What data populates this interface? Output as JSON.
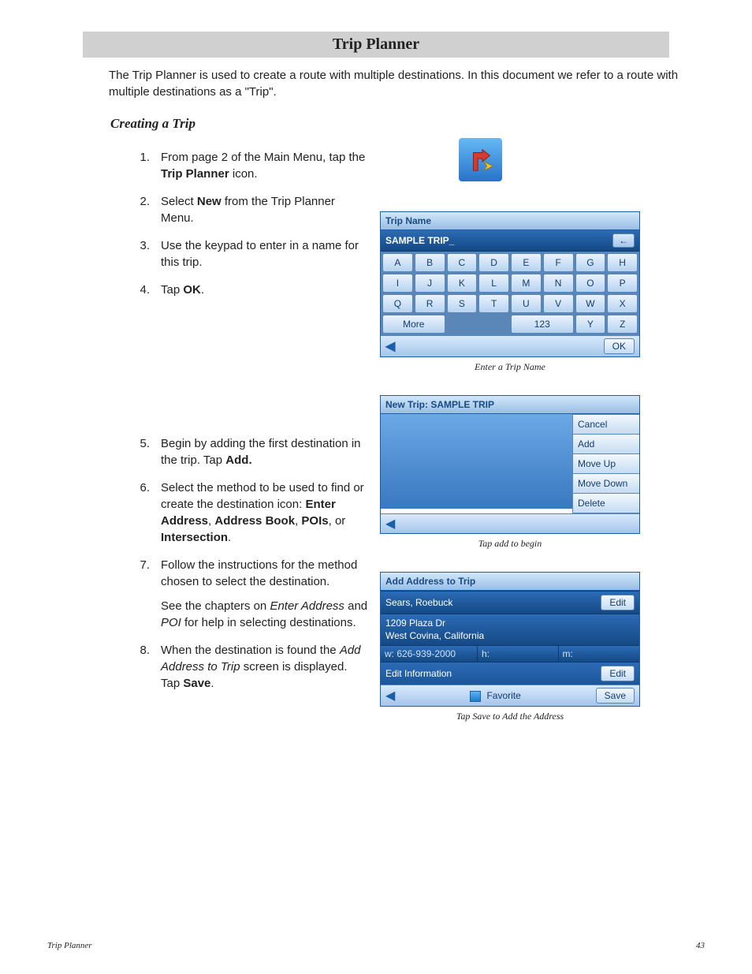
{
  "title": "Trip Planner",
  "intro": "The Trip Planner is used to create a route with multiple destinations.  In this document we refer to a route with multiple destinations as a \"Trip\".",
  "section_heading": "Creating a Trip",
  "steps": {
    "s1_pre": "From page 2 of the Main Menu, tap the ",
    "s1_bold": "Trip Planner",
    "s1_post": " icon.",
    "s2_pre": "Select ",
    "s2_bold": "New",
    "s2_post": " from the Trip Planner Menu.",
    "s3": "Use the keypad to enter in a name for this trip.",
    "s4_pre": "Tap ",
    "s4_bold": "OK",
    "s4_post": ".",
    "s5_pre": "Begin by adding the first destination in the trip.  Tap ",
    "s5_bold": "Add.",
    "s6_pre": "Select the method to be used to find or create the destination icon: ",
    "s6_b1": "Enter Address",
    "s6_c1": ", ",
    "s6_b2": "Address Book",
    "s6_c2": ", ",
    "s6_b3": "POIs",
    "s6_c3": ", or ",
    "s6_b4": "Intersection",
    "s6_c4": ".",
    "s7": "Follow the instructions for the method chosen to select the destination.",
    "s7_sub_pre": "See the chapters on ",
    "s7_sub_i1": "Enter Address",
    "s7_sub_mid": " and ",
    "s7_sub_i2": "POI",
    "s7_sub_post": " for help in selecting destinations.",
    "s8_pre": "When the destination is found the ",
    "s8_i": "Add Address to Trip",
    "s8_mid": " screen is displayed.  Tap ",
    "s8_bold": "Save",
    "s8_post": "."
  },
  "nums": {
    "n1": "1.",
    "n2": "2.",
    "n3": "3.",
    "n4": "4.",
    "n5": "5.",
    "n6": "6.",
    "n7": "7.",
    "n8": "8."
  },
  "screen1": {
    "header": "Trip Name",
    "input_value": "SAMPLE TRIP_",
    "keys_row1": [
      "A",
      "B",
      "C",
      "D",
      "E",
      "F",
      "G",
      "H"
    ],
    "keys_row2": [
      "I",
      "J",
      "K",
      "L",
      "M",
      "N",
      "O",
      "P"
    ],
    "keys_row3": [
      "Q",
      "R",
      "S",
      "T",
      "U",
      "V",
      "W",
      "X"
    ],
    "more_label": "More",
    "num_label": "123",
    "y_label": "Y",
    "z_label": "Z",
    "ok_label": "OK",
    "back_glyph": "←"
  },
  "caption1": "Enter a Trip Name",
  "screen2": {
    "header": "New Trip: SAMPLE TRIP",
    "buttons": [
      "Cancel",
      "Add",
      "Move Up",
      "Move Down",
      "Delete"
    ]
  },
  "caption2": "Tap add to begin",
  "screen3": {
    "header": "Add Address to Trip",
    "name": "Sears, Roebuck",
    "edit_label": "Edit",
    "addr_l1": "1209 Plaza Dr",
    "addr_l2": "West Covina, California",
    "w": "w: 626-939-2000",
    "h": "h:",
    "m": "m:",
    "edit_info": "Edit Information",
    "favorite": "Favorite",
    "save": "Save"
  },
  "caption3": "Tap Save to Add the Address",
  "footer_left": "Trip Planner",
  "footer_right": "43"
}
